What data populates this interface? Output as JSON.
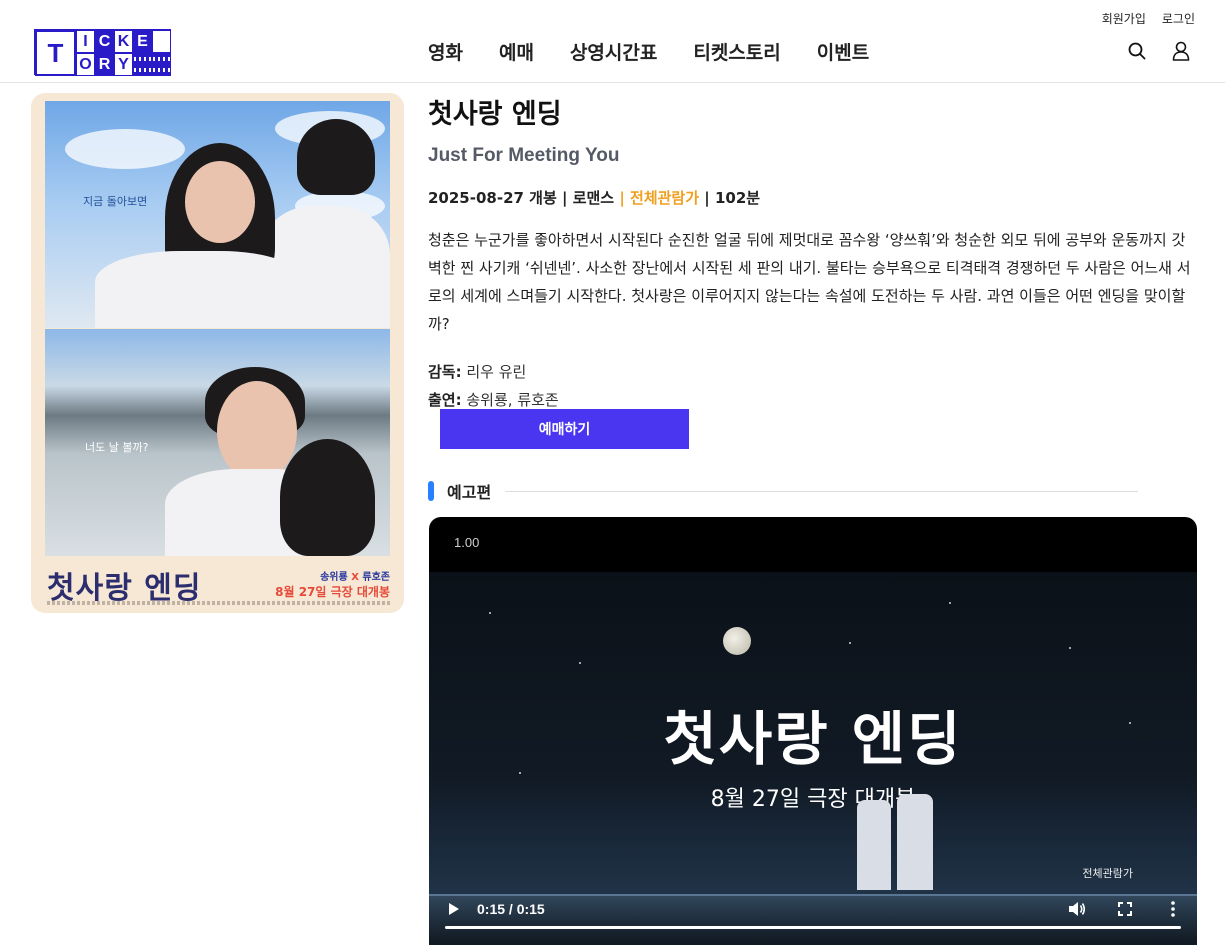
{
  "header": {
    "util_links": {
      "signup": "회원가입",
      "login": "로그인"
    },
    "logo": {
      "big": "T",
      "row1": [
        "I",
        "C",
        "K",
        "E"
      ],
      "row2": [
        "O",
        "R",
        "Y"
      ]
    },
    "nav": [
      "영화",
      "예매",
      "상영시간표",
      "티켓스토리",
      "이벤트"
    ],
    "icons": [
      "search-icon",
      "user-icon"
    ]
  },
  "poster": {
    "caption_top": "지금 돌아보면",
    "caption_bottom": "너도 날 볼까?",
    "title_art": "첫사랑 엔딩",
    "cast_1": "송위룡",
    "cast_sep": "X",
    "cast_2": "류호존",
    "release": "8월 27일 극장 대개봉"
  },
  "movie": {
    "title_kr": "첫사랑 엔딩",
    "title_en": "Just For Meeting You",
    "meta_release": "2025-08-27 개봉 | 로맨스 ",
    "meta_rating": "| 전체관람가",
    "meta_runtime": " | 102분",
    "synopsis": "청춘은 누군가를 좋아하면서 시작된다 순진한 얼굴 뒤에 제멋대로 꼼수왕 ‘양쓰훠’와 청순한 외모 뒤에 공부와 운동까지 갓벽한 찐 사기캐 ‘쉬넨넨’. 사소한 장난에서 시작된 세 판의 내기. 불타는 승부욕으로 티격태격 경쟁하던 두 사람은 어느새 서로의 세계에 스며들기 시작한다. 첫사랑은 이루어지지 않는다는 속설에 도전하는 두 사람. 과연 이들은 어떤 엔딩을 맞이할까?",
    "director_label": "감독:",
    "director": " 리우 유린",
    "cast_label": "출연:",
    "cast": " 송위룡, 류호존"
  },
  "actions": {
    "book": "예매하기"
  },
  "trailer": {
    "section_label": "예고편",
    "speed": "1.00",
    "video_title": "첫사랑 엔딩",
    "video_subtitle": "8월 27일 극장 대개봉",
    "video_rating": "전체관람가",
    "time": "0:15 / 0:15",
    "progress": 1.0
  },
  "colors": {
    "brand": "#2a1bc9",
    "button": "#4a36f0",
    "rating": "#f0a020",
    "section_bar": "#2680ff"
  }
}
